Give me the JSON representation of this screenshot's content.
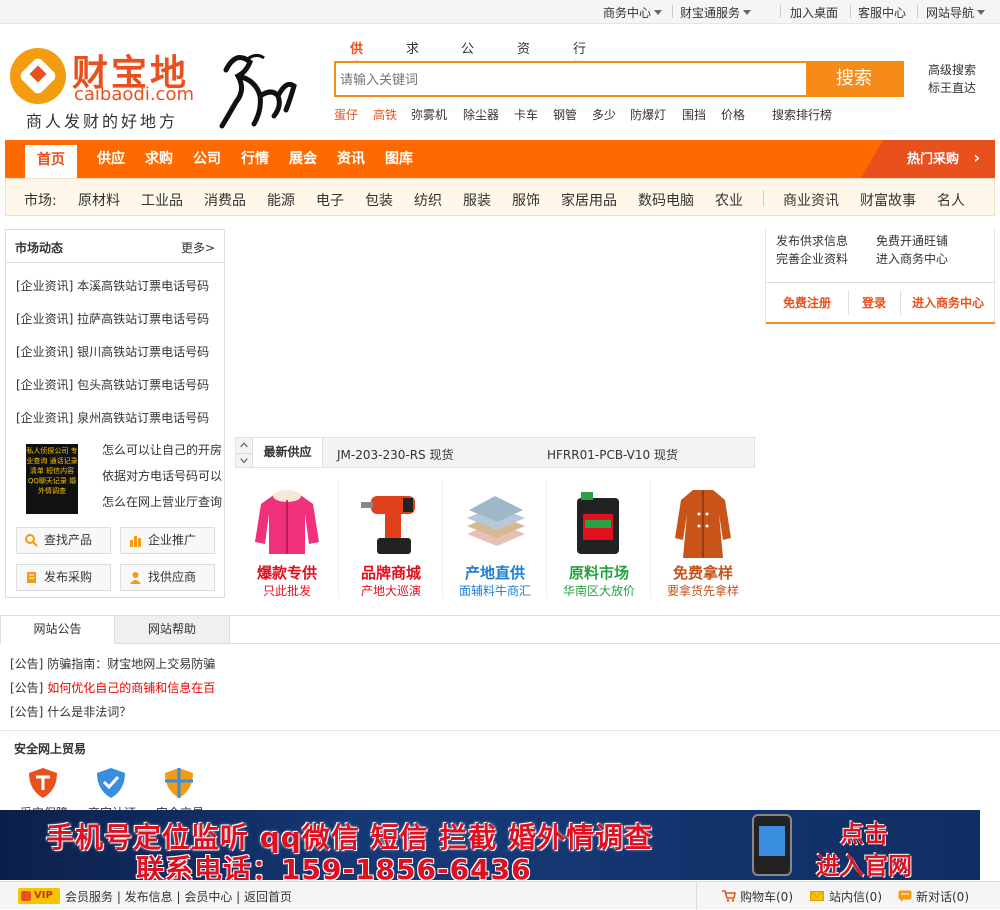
{
  "topbar": {
    "business_center": "商务中心",
    "caibaotong": "财宝通服务",
    "add_desktop": "加入桌面",
    "customer_center": "客服中心",
    "site_nav": "网站导航"
  },
  "logo": {
    "cn": "财宝地",
    "en": "caibaodi.com",
    "slogan": "商人发财的好地方"
  },
  "search": {
    "tabs": [
      "供应",
      "求购",
      "公司",
      "资讯",
      "行情"
    ],
    "placeholder": "请输入关键词",
    "button": "搜索",
    "advanced": "高级搜索",
    "direct": "标王直达",
    "hot_words": [
      "蛋仔",
      "高铁",
      "弥雾机",
      "除尘器",
      "卡车",
      "钢管",
      "多少",
      "防爆灯",
      "围挡",
      "价格"
    ],
    "ranking": "搜索排行榜"
  },
  "nav": {
    "items": [
      "首页",
      "供应",
      "求购",
      "公司",
      "行情",
      "展会",
      "资讯",
      "图库"
    ],
    "hot": "热门采购",
    "hot_arrow": "›"
  },
  "subnav": {
    "label": "市场:",
    "items": [
      "原材料",
      "工业品",
      "消费品",
      "能源",
      "电子",
      "包装",
      "纺织",
      "服装",
      "服饰",
      "家居用品",
      "数码电脑",
      "农业"
    ],
    "extra": [
      "商业资讯",
      "财富故事",
      "名人"
    ]
  },
  "market": {
    "title": "市场动态",
    "more": "更多>",
    "news": [
      "[企业资讯] 本溪高铁站订票电话号码",
      "[企业资讯] 拉萨高铁站订票电话号码",
      "[企业资讯] 银川高铁站订票电话号码",
      "[企业资讯] 包头高铁站订票电话号码",
      "[企业资讯] 泉州高铁站订票电话号码"
    ],
    "ad_text": "私人侦探公司 专业查询 通话记录清单 短信内容 QQ聊天记录 婚外情调查",
    "questions": [
      "怎么可以让自己的开房",
      "依据对方电话号码可以",
      "怎么在网上营业厅查询"
    ],
    "buttons": [
      "查找产品",
      "企业推广",
      "发布采购",
      "找供应商"
    ]
  },
  "right_panel": {
    "links": [
      "发布供求信息",
      "免费开通旺铺",
      "完善企业资料",
      "进入商务中心"
    ],
    "tabs": [
      "免费注册",
      "登录",
      "进入商务中心"
    ]
  },
  "supply": {
    "label": "最新供应",
    "items": [
      "JM-203-230-RS 现货",
      "HFRR01-PCB-V10 现货"
    ]
  },
  "categories": [
    {
      "title": "爆款专供",
      "sub": "只此批发",
      "color": "#e0101f"
    },
    {
      "title": "品牌商城",
      "sub": "产地大巡演",
      "color": "#e0101f"
    },
    {
      "title": "产地直供",
      "sub": "面辅料牛商汇",
      "color": "#1a7fd4"
    },
    {
      "title": "原料市场",
      "sub": "华南区大放价",
      "color": "#2aa142"
    },
    {
      "title": "免费拿样",
      "sub": "要拿货先拿样",
      "color": "#c8541a"
    }
  ],
  "notice": {
    "tabs": [
      "网站公告",
      "网站帮助"
    ],
    "items": [
      {
        "prefix": "[公告]",
        "text": "防骗指南：财宝地网上交易防骗",
        "red": false
      },
      {
        "prefix": "[公告]",
        "text": "如何优化自己的商铺和信息在百",
        "red": true
      },
      {
        "prefix": "[公告]",
        "text": "什么是非法词？",
        "red": false
      }
    ],
    "safe_title": "安全网上贸易",
    "safe_items": [
      "采宝保障",
      "商家认证",
      "安全交易"
    ]
  },
  "banner": {
    "line1": "手机号定位监听 qq微信 短信 拦截 婚外情调查",
    "line2": "联系电话：159-1856-6436",
    "cta1": "点击",
    "cta2": "进入官网"
  },
  "footer": {
    "vip": "VIP",
    "links": "会员服务 | 发布信息 | 会员中心 | 返回首页",
    "cart": "购物车(0)",
    "inbox": "站内信(0)",
    "new_msg": "新对话(0)"
  },
  "colors": {
    "brand_orange": "#ff6a00",
    "accent_red": "#e8501e"
  }
}
